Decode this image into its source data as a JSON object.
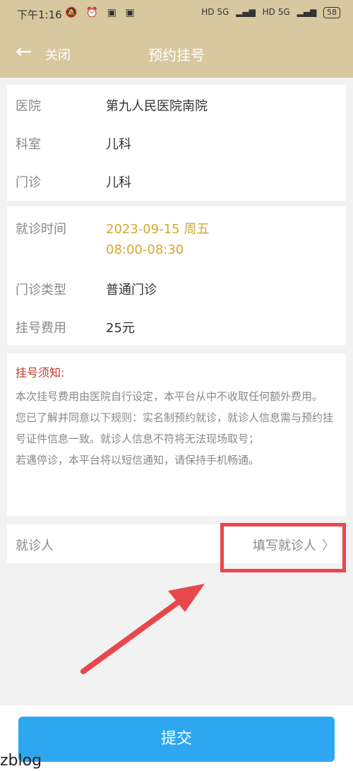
{
  "status_bar": {
    "time": "下午1:16",
    "icons": [
      "mute-icon",
      "alarm-icon",
      "app-icon-1",
      "app-icon-2"
    ],
    "network_1": "HD 5G",
    "network_2": "HD 5G",
    "battery": "58"
  },
  "header": {
    "close_label": "关闭",
    "title": "预约挂号"
  },
  "hospital_info": [
    {
      "label": "医院",
      "value": "第九人民医院南院"
    },
    {
      "label": "科室",
      "value": "儿科"
    },
    {
      "label": "门诊",
      "value": "儿科"
    }
  ],
  "visit_info": {
    "time_label": "就诊时间",
    "time_date": "2023-09-15  周五",
    "time_range": "08:00-08:30",
    "type_label": "门诊类型",
    "type_value": "普通门诊",
    "fee_label": "挂号费用",
    "fee_value": "25元"
  },
  "notice": {
    "title": "挂号须知:",
    "paragraphs": [
      "本次挂号费用由医院自行设定，本平台从中不收取任何额外费用。",
      "您已了解并同意以下规则：实名制预约就诊，就诊人信息需与预约挂号证件信息一致。就诊人信息不符将无法现场取号；",
      "若遇停诊，本平台将以短信通知，请保持手机畅通。"
    ]
  },
  "patient": {
    "label": "就诊人",
    "fill_label": "填写就诊人"
  },
  "submit_label": "提交",
  "watermark": "zblog",
  "colors": {
    "header_bg": "#d8c8a0",
    "accent_gold": "#d4a72c",
    "notice_red": "#c0392b",
    "highlight_red": "#e8474c",
    "submit_blue": "#2fa7f0"
  }
}
